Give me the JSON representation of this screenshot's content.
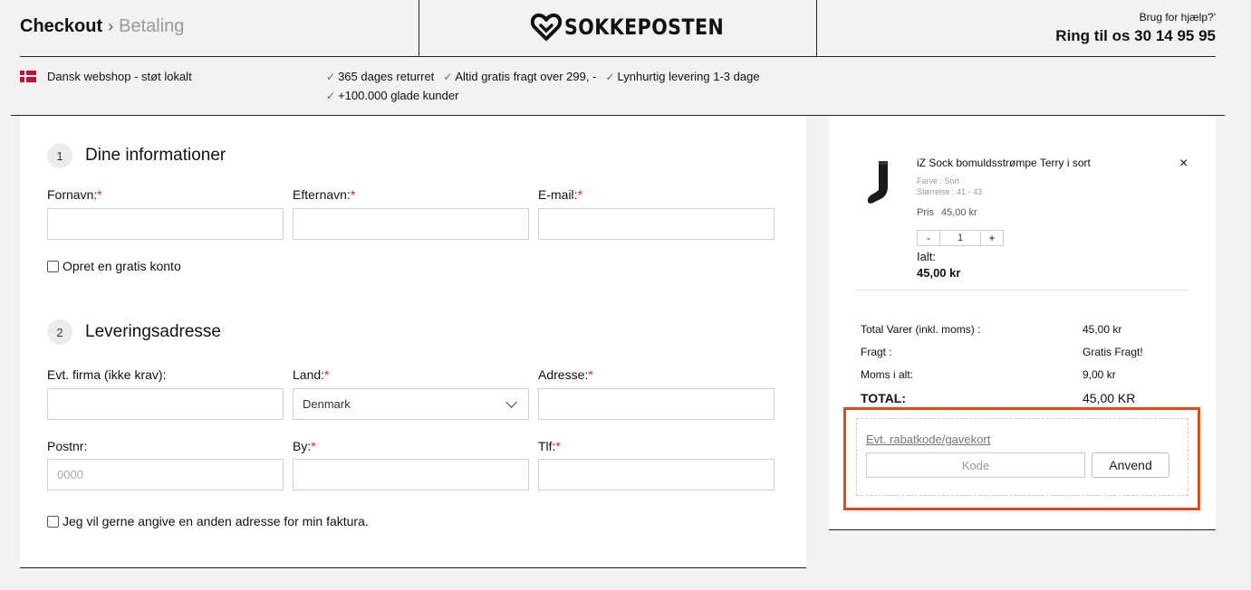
{
  "header": {
    "breadcrumb": {
      "current": "Checkout",
      "separator": "›",
      "next": "Betaling"
    },
    "logo_text": "SOKKEPOSTEN",
    "help": {
      "question": "Brug for hjælp?'",
      "phone": "Ring til os 30 14 95 95"
    }
  },
  "usp": {
    "left": "Dansk webshop - støt lokalt",
    "items": [
      "365 dages returret",
      "Altid gratis fragt over 299, -",
      "Lynhurtig levering 1-3 dage",
      "+100.000 glade kunder"
    ]
  },
  "form": {
    "step1": {
      "number": "1",
      "title": "Dine informationer"
    },
    "fornavn": {
      "label": "Fornavn:",
      "value": ""
    },
    "efternavn": {
      "label": "Efternavn:",
      "value": ""
    },
    "email": {
      "label": "E-mail:",
      "value": ""
    },
    "create_account": "Opret en gratis konto",
    "step2": {
      "number": "2",
      "title": "Leveringsadresse"
    },
    "firma": {
      "label": "Evt. firma (ikke krav):",
      "value": ""
    },
    "land": {
      "label": "Land:",
      "value": "Denmark"
    },
    "adresse": {
      "label": "Adresse:",
      "value": ""
    },
    "postnr": {
      "label": "Postnr:",
      "placeholder": "0000"
    },
    "by": {
      "label": "By:",
      "value": ""
    },
    "tlf": {
      "label": "Tlf:",
      "value": ""
    },
    "required_mark": "*",
    "alt_billing": "Jeg vil gerne angive en anden adresse for min faktura."
  },
  "cart": {
    "product": {
      "name": "iZ Sock bomuldsstrømpe Terry i sort",
      "color": "Farve : Sort",
      "size": "Størrelse : 41 - 43",
      "price_label": "Pris",
      "price": "45,00 kr",
      "qty_minus": "-",
      "qty": "1",
      "qty_plus": "+",
      "total_label": "Ialt:",
      "total": "45,00 kr",
      "remove": "×"
    },
    "summary": {
      "items_label": "Total Varer  (inkl. moms) :",
      "items_value": "45,00 kr",
      "shipping_label": "Fragt :",
      "shipping_value": "Gratis Fragt!",
      "vat_label": "Moms i alt:",
      "vat_value": "9,00 kr",
      "total_label": "TOTAL:",
      "total_value": "45,00 KR"
    },
    "discount": {
      "link": "Evt. rabatkode/gavekort",
      "placeholder": "Kode",
      "button": "Anvend"
    }
  },
  "colors": {
    "highlight": "#e04a16",
    "required": "#dd2222",
    "flag": "#c8102e"
  }
}
